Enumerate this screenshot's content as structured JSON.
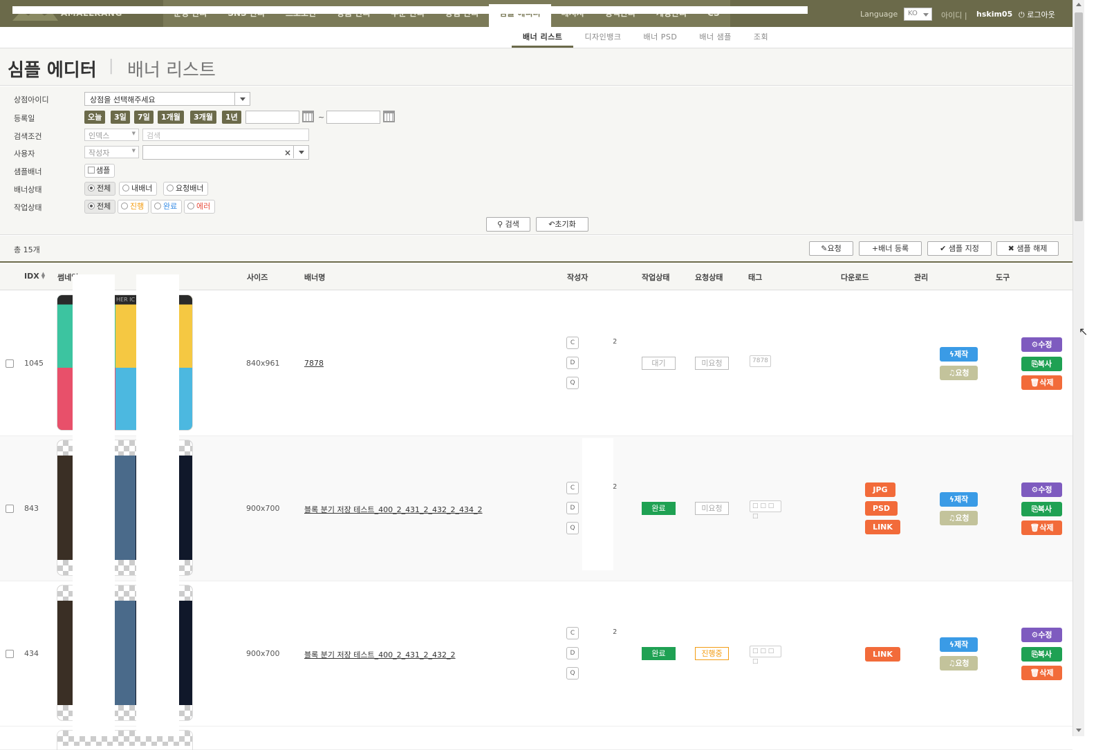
{
  "header": {
    "logo_text": "AMALLKANG",
    "nav": [
      "운영 관리",
      "SNS 관리",
      "프로모션",
      "상품 관리",
      "주문 관리",
      "상점 관리",
      "심플 에디터",
      "메시지",
      "정책관리",
      "계정관리",
      "CS"
    ],
    "active_nav": "심플 에디터",
    "language_label": "Language",
    "language_value": "KO",
    "user_id_label": "아이디 |",
    "username": "hskim05",
    "logout_label": "로그아웃"
  },
  "subnav": {
    "items": [
      "배너 리스트",
      "디자인뱅크",
      "배너 PSD",
      "배너 샘플",
      "조회"
    ],
    "active": "배너 리스트"
  },
  "title": {
    "main": "심플 에디터",
    "sub": "배너 리스트"
  },
  "filter": {
    "store_label": "상점아이디",
    "store_value": "상점을 선택해주세요",
    "date_label": "등록일",
    "date_buttons": [
      "오늘",
      "3일",
      "7일",
      "1개월",
      "3개월",
      "1년"
    ],
    "date_sep": "~",
    "condition_label": "검색조건",
    "condition_select": "인덱스",
    "condition_placeholder": "검색",
    "user_label": "사용자",
    "user_select": "작성자",
    "user_clear": "×",
    "sample_label": "샘플배너",
    "sample_check": "샘플",
    "banner_status_label": "배너상태",
    "banner_status": [
      "전체",
      "내배너",
      "요청배너"
    ],
    "work_status_label": "작업상태",
    "work_status": [
      "전체",
      "진행",
      "완료",
      "에러"
    ],
    "search_button": "검색",
    "reset_button": "초기화"
  },
  "list": {
    "total": "총 15개",
    "actions": [
      "요청",
      "배너 등록",
      "샘플 지정",
      "샘플 해제"
    ],
    "columns": [
      "IDX",
      "썸네일",
      "사이즈",
      "배너명",
      "작성자",
      "작업상태",
      "요청상태",
      "태그",
      "다운로드",
      "관리",
      "도구"
    ],
    "thumb_text": "HER IC",
    "cdq": [
      "C",
      "D",
      "Q"
    ],
    "manage": [
      "제작",
      "요청"
    ],
    "tools": [
      "수정",
      "복사",
      "삭제"
    ],
    "rows": [
      {
        "idx": "1045",
        "size": "840x961",
        "name": "7878",
        "writer_count": "2",
        "work_status": "대기",
        "request_status": "미요청",
        "tag": "7878",
        "downloads": []
      },
      {
        "idx": "843",
        "size": "900x700",
        "name": "블록 분기 저장 테스트_400_2_431_2_432_2_434_2",
        "writer_count": "2",
        "work_status": "완료",
        "request_status": "미요청",
        "tag": "□ □ □ □",
        "downloads": [
          "JPG",
          "PSD",
          "LINK"
        ]
      },
      {
        "idx": "434",
        "size": "900x700",
        "name": "블록 분기 저장 테스트_400_2_431_2_432_2",
        "writer_count": "2",
        "work_status": "완료",
        "request_status": "진행중",
        "tag": "□ □ □ □",
        "downloads": [
          "LINK"
        ]
      }
    ]
  },
  "colors": {
    "header_bg": "#6b6a4a",
    "green": "#1fa153",
    "orange": "#f26b3a",
    "purple": "#7e5bbf",
    "blue": "#3a9be6",
    "khaki": "#c3c39b"
  }
}
